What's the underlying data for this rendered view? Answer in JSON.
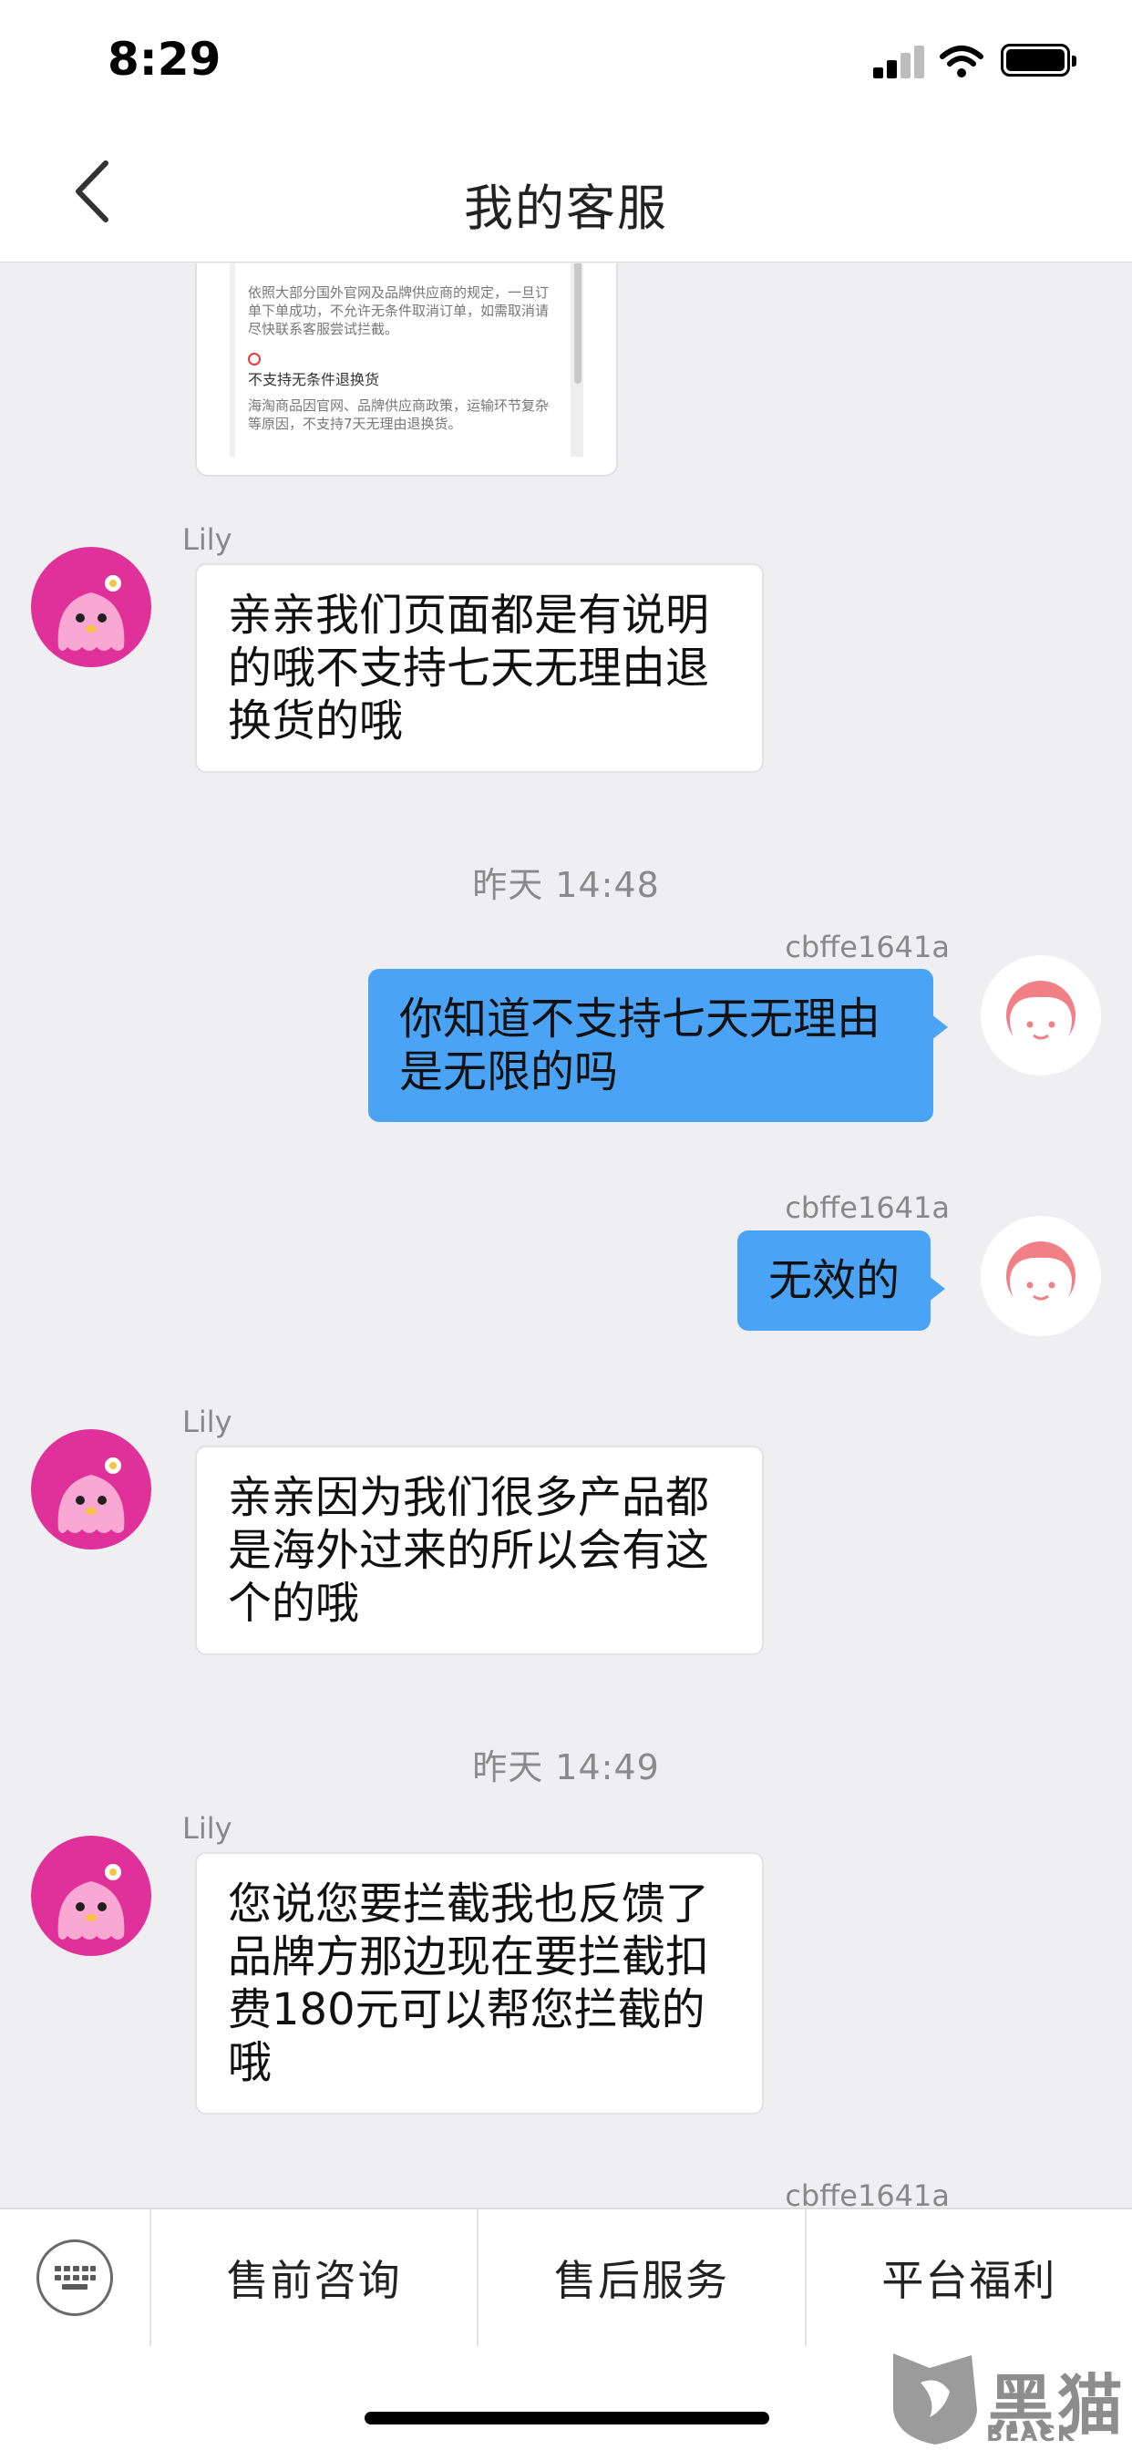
{
  "status_bar": {
    "time": "8:29"
  },
  "header": {
    "title": "我的客服"
  },
  "card_preview": {
    "paragraph": "依照大部分国外官网及品牌供应商的规定，一旦订单下单成功，不允许无条件取消订单，如需取消请尽快联系客服尝试拦截。",
    "heading": "不支持无条件退换货",
    "note": "海淘商品因官网、品牌供应商政策，运输环节复杂等原因，不支持7天无理由退换货。"
  },
  "messages": [
    {
      "sender": "Lily",
      "text": "亲亲我们页面都是有说明的哦不支持七天无理由退换货的哦"
    },
    {
      "time": "昨天 14:48"
    },
    {
      "sender": "cbffe1641a",
      "text": "你知道不支持七天无理由是无限的吗"
    },
    {
      "sender": "cbffe1641a",
      "text": "无效的"
    },
    {
      "sender": "Lily",
      "text": "亲亲因为我们很多产品都是海外过来的所以会有这个的哦"
    },
    {
      "time": "昨天 14:49"
    },
    {
      "sender": "Lily",
      "text": "您说您要拦截我也反馈了品牌方那边现在要拦截扣费180元可以帮您拦截的哦"
    },
    {
      "sender": "cbffe1641a"
    }
  ],
  "bottom_menu": {
    "items": [
      "售前咨询",
      "售后服务",
      "平台福利"
    ]
  },
  "watermark": {
    "cn": "黑猫",
    "en": "BLACK CAT"
  },
  "colors": {
    "outgoing_bubble": "#4aa3f4",
    "agent_avatar": "#e0309a",
    "user_avatar_face": "#f07f86",
    "background": "#efeff1"
  },
  "icons": [
    "back-chevron-icon",
    "signal-icon",
    "wifi-icon",
    "battery-icon",
    "keyboard-icon",
    "agent-avatar",
    "user-avatar",
    "check-icon"
  ]
}
